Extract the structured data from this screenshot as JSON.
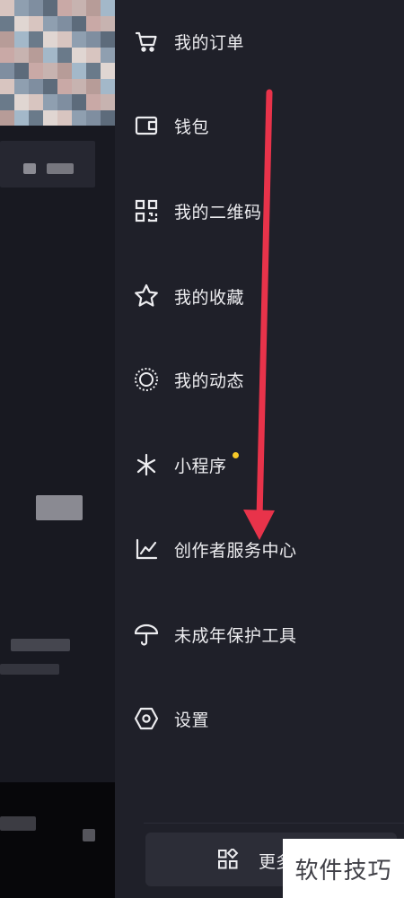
{
  "menu": {
    "items": [
      {
        "label": "我的订单",
        "icon": "shopping-cart-icon"
      },
      {
        "label": "钱包",
        "icon": "wallet-icon"
      },
      {
        "label": "我的二维码",
        "icon": "qr-code-icon"
      },
      {
        "label": "我的收藏",
        "icon": "star-icon"
      },
      {
        "label": "我的动态",
        "icon": "moments-ring-icon"
      },
      {
        "label": "小程序",
        "icon": "mini-program-icon",
        "badge_dot": true
      },
      {
        "label": "创作者服务中心",
        "icon": "line-chart-icon"
      },
      {
        "label": "未成年保护工具",
        "icon": "umbrella-icon"
      },
      {
        "label": "设置",
        "icon": "settings-hexagon-icon"
      }
    ]
  },
  "more": {
    "label": "更多",
    "icon": "grid-apps-icon"
  },
  "watermark": {
    "text": "软件技巧"
  },
  "colors": {
    "drawer_bg": "#1f2029",
    "text": "#ececef",
    "badge": "#f7c928",
    "arrow": "#e8334a"
  }
}
